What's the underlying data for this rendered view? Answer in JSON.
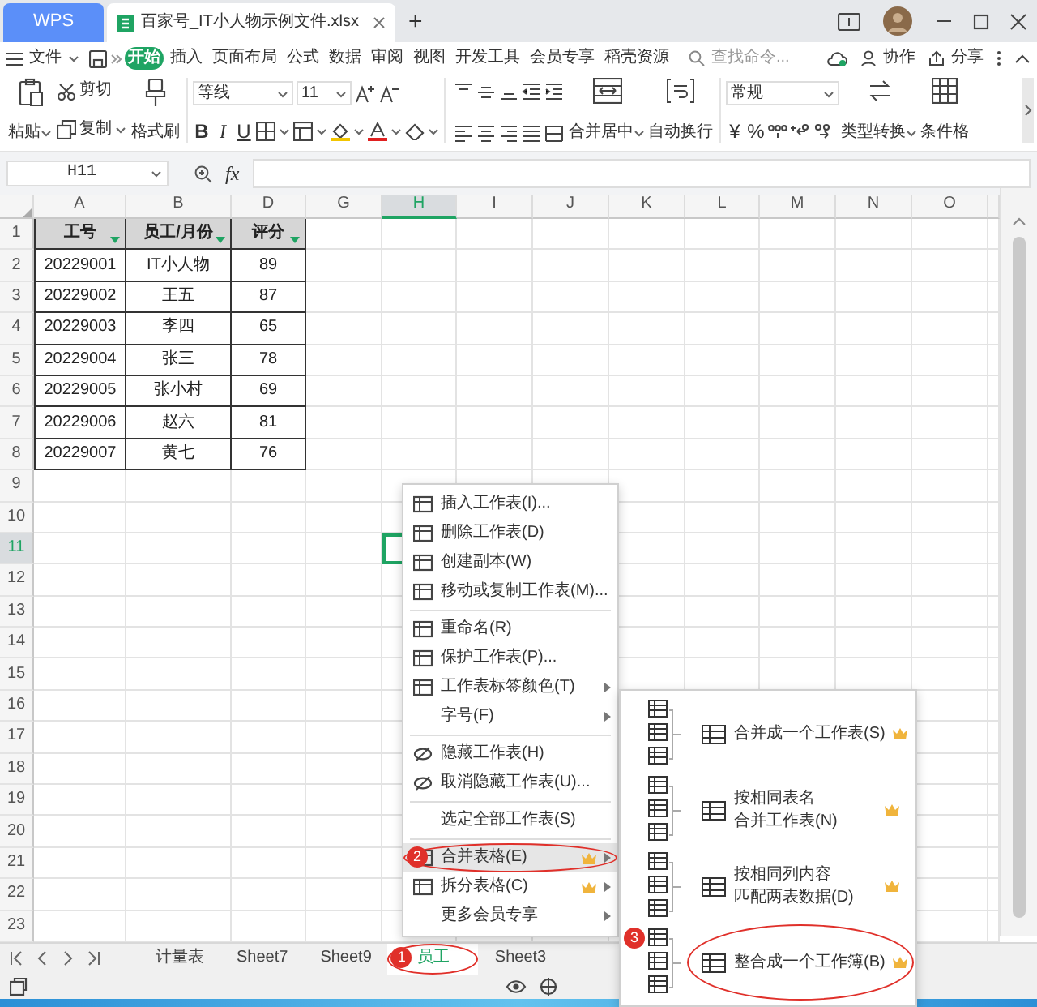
{
  "title_bar": {
    "app_tab": "WPS",
    "document_tab": {
      "title": "百家号_IT小人物示例文件.xlsx",
      "selected": true
    },
    "new_tab": "+"
  },
  "menu_bar": {
    "file_menu": "文件",
    "tabs": [
      {
        "label": "开始",
        "selected": true
      },
      {
        "label": "插入",
        "selected": false
      },
      {
        "label": "页面布局",
        "selected": false
      },
      {
        "label": "公式",
        "selected": false
      },
      {
        "label": "数据",
        "selected": false
      },
      {
        "label": "审阅",
        "selected": false
      },
      {
        "label": "视图",
        "selected": false
      },
      {
        "label": "开发工具",
        "selected": false
      },
      {
        "label": "会员专享",
        "selected": false
      },
      {
        "label": "稻壳资源",
        "selected": false
      }
    ],
    "search": {
      "placeholder": "查找命令..."
    },
    "collaborate": "协作",
    "share": "分享"
  },
  "ribbon": {
    "paste": "粘贴",
    "cut": "剪切",
    "copy": "复制",
    "format_painter": "格式刷",
    "font_name": "等线",
    "font_size": "11",
    "bold": "B",
    "italic": "I",
    "underline": "U",
    "merge_center": "合并居中",
    "wrap_text": "自动换行",
    "number_format": "常规",
    "currency": "¥",
    "percent": "%",
    "type_convert": "类型转换",
    "conditional_format": "条件格"
  },
  "formula_bar": {
    "name_box": "H11",
    "function_label": "fx"
  },
  "sheet": {
    "columns": [
      {
        "label": "A",
        "selected": false
      },
      {
        "label": "B",
        "selected": false
      },
      {
        "label": "D",
        "selected": false
      },
      {
        "label": "G",
        "selected": false
      },
      {
        "label": "H",
        "selected": true
      },
      {
        "label": "I",
        "selected": false
      },
      {
        "label": "J",
        "selected": false
      },
      {
        "label": "K",
        "selected": false
      },
      {
        "label": "L",
        "selected": false
      },
      {
        "label": "M",
        "selected": false
      },
      {
        "label": "N",
        "selected": false
      },
      {
        "label": "O",
        "selected": false
      }
    ],
    "rows": [
      {
        "label": "1",
        "selected": false
      },
      {
        "label": "2",
        "selected": false
      },
      {
        "label": "3",
        "selected": false
      },
      {
        "label": "4",
        "selected": false
      },
      {
        "label": "5",
        "selected": false
      },
      {
        "label": "6",
        "selected": false
      },
      {
        "label": "7",
        "selected": false
      },
      {
        "label": "8",
        "selected": false
      },
      {
        "label": "9",
        "selected": false
      },
      {
        "label": "10",
        "selected": false
      },
      {
        "label": "11",
        "selected": true
      },
      {
        "label": "12",
        "selected": false
      },
      {
        "label": "13",
        "selected": false
      },
      {
        "label": "14",
        "selected": false
      },
      {
        "label": "15",
        "selected": false
      },
      {
        "label": "16",
        "selected": false
      },
      {
        "label": "17",
        "selected": false
      },
      {
        "label": "18",
        "selected": false
      },
      {
        "label": "19",
        "selected": false
      },
      {
        "label": "20",
        "selected": false
      },
      {
        "label": "21",
        "selected": false
      },
      {
        "label": "22",
        "selected": false
      },
      {
        "label": "23",
        "selected": false
      }
    ],
    "table": {
      "header": [
        "工号",
        "员工/月份",
        "评分"
      ],
      "rows": [
        [
          "20229001",
          "IT小人物",
          "89"
        ],
        [
          "20229002",
          "王五",
          "87"
        ],
        [
          "20229003",
          "李四",
          "65"
        ],
        [
          "20229004",
          "张三",
          "78"
        ],
        [
          "20229005",
          "张小村",
          "69"
        ],
        [
          "20229006",
          "赵六",
          "81"
        ],
        [
          "20229007",
          "黄七",
          "76"
        ]
      ]
    }
  },
  "context_menu": [
    {
      "kind": "sheet",
      "label": "插入工作表(I)...",
      "submenu": false,
      "vip": false,
      "selected": false,
      "circled": false
    },
    {
      "kind": "sheet",
      "label": "删除工作表(D)",
      "submenu": false,
      "vip": false,
      "selected": false,
      "circled": false
    },
    {
      "kind": "sheet",
      "label": "创建副本(W)",
      "submenu": false,
      "vip": false,
      "selected": false,
      "circled": false
    },
    {
      "kind": "sheet",
      "label": "移动或复制工作表(M)...",
      "submenu": false,
      "vip": false,
      "selected": false,
      "circled": false
    },
    {
      "kind": "separator"
    },
    {
      "kind": "sheet",
      "label": "重命名(R)",
      "submenu": false,
      "vip": false,
      "selected": false,
      "circled": false
    },
    {
      "kind": "sheet",
      "label": "保护工作表(P)...",
      "submenu": false,
      "vip": false,
      "selected": false,
      "circled": false
    },
    {
      "kind": "sheet",
      "label": "工作表标签颜色(T)",
      "submenu": true,
      "vip": false,
      "selected": false,
      "circled": false
    },
    {
      "kind": "plain",
      "label": "字号(F)",
      "submenu": true,
      "vip": false,
      "selected": false,
      "circled": false
    },
    {
      "kind": "separator"
    },
    {
      "kind": "hide",
      "label": "隐藏工作表(H)",
      "submenu": false,
      "vip": false,
      "selected": false,
      "circled": false
    },
    {
      "kind": "hide",
      "label": "取消隐藏工作表(U)...",
      "submenu": false,
      "vip": false,
      "selected": false,
      "circled": false
    },
    {
      "kind": "separator"
    },
    {
      "kind": "plain",
      "label": "选定全部工作表(S)",
      "submenu": false,
      "vip": false,
      "selected": false,
      "circled": false
    },
    {
      "kind": "separator"
    },
    {
      "kind": "sheet",
      "label": "合并表格(E)",
      "submenu": true,
      "vip": true,
      "selected": true,
      "circled": true
    },
    {
      "kind": "sheet",
      "label": "拆分表格(C)",
      "submenu": true,
      "vip": true,
      "selected": false,
      "circled": false
    },
    {
      "kind": "plain",
      "label": "更多会员专享",
      "submenu": true,
      "vip": false,
      "selected": false,
      "circled": false
    }
  ],
  "submenu": [
    {
      "lines": [
        "合并成一个工作表(S)"
      ],
      "vip": true,
      "circled": false
    },
    {
      "lines": [
        "按相同表名",
        "合并工作表(N)"
      ],
      "vip": true,
      "circled": false
    },
    {
      "lines": [
        "按相同列内容",
        "匹配两表数据(D)"
      ],
      "vip": true,
      "circled": false
    },
    {
      "lines": [
        "整合成一个工作簿(B)"
      ],
      "vip": true,
      "circled": true
    }
  ],
  "sheet_tabs": [
    {
      "label": "计量表",
      "selected": false,
      "circled": false
    },
    {
      "label": "Sheet7",
      "selected": false,
      "circled": false
    },
    {
      "label": "Sheet9",
      "selected": false,
      "circled": false
    },
    {
      "label": "员工",
      "selected": true,
      "circled": true
    },
    {
      "label": "Sheet3",
      "selected": false,
      "circled": false
    }
  ],
  "annotations": [
    {
      "number": "1",
      "kind": "sheet_tab"
    },
    {
      "number": "2",
      "kind": "menu_item"
    },
    {
      "number": "3",
      "kind": "submenu_item"
    }
  ]
}
